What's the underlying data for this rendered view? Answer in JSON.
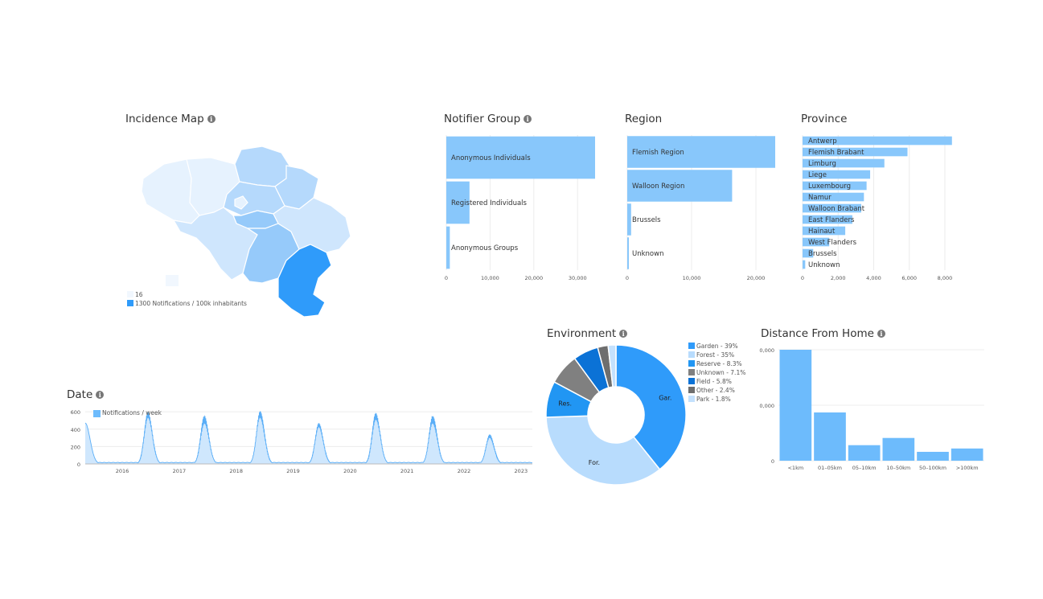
{
  "colors": {
    "bar": "#88c7fb",
    "bar_dark": "#6dbbfc",
    "grid": "#ececec",
    "axis_text": "#555555",
    "map_levels": [
      "#e6f2fe",
      "#cfe6fd",
      "#b5d9fc",
      "#96cafa",
      "#6bb3f6",
      "#2f9bfa"
    ]
  },
  "map": {
    "title": "Incidence Map",
    "info_icon": "info-icon",
    "legend_min": "16",
    "legend_max": "1300 Notifications / 100k inhabitants",
    "regions": [
      {
        "name": "west-flanders",
        "level": 0
      },
      {
        "name": "east-flanders",
        "level": 0
      },
      {
        "name": "antwerp",
        "level": 2
      },
      {
        "name": "limburg",
        "level": 2
      },
      {
        "name": "flemish-brabant",
        "level": 2
      },
      {
        "name": "brussels",
        "level": 0
      },
      {
        "name": "walloon-brabant",
        "level": 3
      },
      {
        "name": "hainaut",
        "level": 1
      },
      {
        "name": "namur",
        "level": 3
      },
      {
        "name": "liege",
        "level": 1
      },
      {
        "name": "luxembourg",
        "level": 5
      }
    ]
  },
  "notifier": {
    "title": "Notifier Group",
    "chart_data": {
      "type": "bar",
      "orientation": "horizontal",
      "categories": [
        "Anonymous Individuals",
        "Registered Individuals",
        "Anonymous Groups"
      ],
      "values": [
        34000,
        5300,
        800
      ],
      "xlim": [
        0,
        34000
      ],
      "xticks": [
        0,
        10000,
        20000,
        30000
      ],
      "xtick_labels": [
        "0",
        "10,000",
        "20,000",
        "30,000"
      ]
    }
  },
  "region": {
    "title": "Region",
    "chart_data": {
      "type": "bar",
      "orientation": "horizontal",
      "categories": [
        "Flemish Region",
        "Walloon Region",
        "Brussels",
        "Unknown"
      ],
      "values": [
        23000,
        16300,
        600,
        150
      ],
      "xlim": [
        0,
        23000
      ],
      "xticks": [
        0,
        10000,
        20000
      ],
      "xtick_labels": [
        "0",
        "10,000",
        "20,000"
      ]
    }
  },
  "province": {
    "title": "Province",
    "chart_data": {
      "type": "bar",
      "orientation": "horizontal",
      "categories": [
        "Antwerp",
        "Flemish Brabant",
        "Limburg",
        "Liege",
        "Luxembourg",
        "Namur",
        "Walloon Brabant",
        "East Flanders",
        "Hainaut",
        "West Flanders",
        "Brussels",
        "Unknown"
      ],
      "values": [
        8400,
        5900,
        4600,
        3800,
        3600,
        3450,
        3300,
        2800,
        2400,
        1500,
        600,
        150
      ],
      "xlim": [
        0,
        8500
      ],
      "xticks": [
        0,
        2000,
        4000,
        6000,
        8000
      ],
      "xtick_labels": [
        "0",
        "2,000",
        "4,000",
        "6,000",
        "8,000"
      ]
    }
  },
  "date": {
    "title": "Date",
    "chart_data": {
      "type": "area",
      "legend": "Notifications / week",
      "ylim": [
        0,
        620
      ],
      "yticks": [
        0,
        200,
        400,
        600
      ],
      "ytick_labels": [
        "0",
        "200",
        "400",
        "600"
      ],
      "xlim": [
        2015.35,
        2023.2
      ],
      "xticks": [
        2016,
        2017,
        2018,
        2019,
        2020,
        2021,
        2022,
        2023
      ],
      "xtick_labels": [
        "2016",
        "2017",
        "2018",
        "2019",
        "2020",
        "2021",
        "2022",
        "2023"
      ],
      "peaks": [
        {
          "year": 2016.45,
          "value": 600
        },
        {
          "year": 2017.44,
          "value": 560
        },
        {
          "year": 2018.42,
          "value": 610
        },
        {
          "year": 2019.45,
          "value": 470
        },
        {
          "year": 2020.45,
          "value": 590
        },
        {
          "year": 2021.45,
          "value": 560
        },
        {
          "year": 2022.45,
          "value": 340
        }
      ],
      "start_value": 470
    }
  },
  "environment": {
    "title": "Environment",
    "chart_data": {
      "type": "pie",
      "donut": true,
      "slices": [
        {
          "label": "Garden - 39%",
          "short": "Gar.",
          "value": 39,
          "color": "#2f9bfa"
        },
        {
          "label": "Forest - 35%",
          "short": "For.",
          "value": 35,
          "color": "#b8dcfd"
        },
        {
          "label": "Reserve - 8.3%",
          "short": "Res.",
          "value": 8.3,
          "color": "#2196f3"
        },
        {
          "label": "Unknown - 7.1%",
          "short": "",
          "value": 7.1,
          "color": "#808080"
        },
        {
          "label": "Field - 5.8%",
          "short": "",
          "value": 5.8,
          "color": "#0b72d6"
        },
        {
          "label": "Other - 2.4%",
          "short": "",
          "value": 2.4,
          "color": "#6e6e6e"
        },
        {
          "label": "Park - 1.8%",
          "short": "",
          "value": 1.8,
          "color": "#c4e1fd"
        }
      ]
    }
  },
  "distance": {
    "title": "Distance From Home",
    "chart_data": {
      "type": "bar",
      "categories": [
        "<1km",
        "01–05km",
        "05–10km",
        "10–50km",
        "50–100km",
        ">100km"
      ],
      "values": [
        20000,
        8700,
        2800,
        4100,
        1600,
        2200
      ],
      "ylim": [
        0,
        20000
      ],
      "ytick_labels": [
        "0",
        "0,000",
        "0,000"
      ],
      "yticks": [
        0,
        10000,
        20000
      ]
    }
  }
}
